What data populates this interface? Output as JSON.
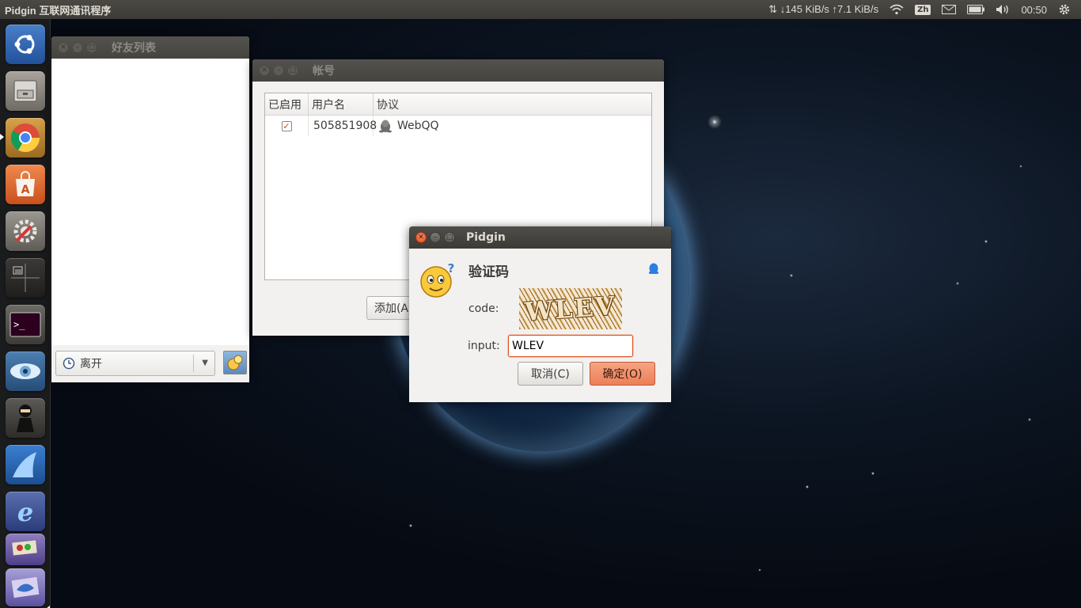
{
  "top_panel": {
    "app_title": "Pidgin 互联网通讯程序",
    "net_speed": "⇅ ↓145 KiB/s ↑7.1 KiB/s",
    "input_method": "Zh",
    "clock": "00:50",
    "icons": [
      "network-updown-icon",
      "wifi-icon",
      "mail-icon",
      "battery-icon",
      "volume-icon",
      "gear-icon"
    ]
  },
  "launcher": {
    "items": [
      "ubuntu-dash",
      "files",
      "chromium",
      "software-center",
      "system-settings",
      "workspace-switcher",
      "terminal",
      "eye-app",
      "ninja-app",
      "shark-app",
      "browser-e",
      "stacked-apps"
    ]
  },
  "buddy_window": {
    "title": "好友列表",
    "status_value": "离开"
  },
  "accounts_window": {
    "title": "帐号",
    "columns": [
      "已启用",
      "用户名",
      "协议"
    ],
    "rows": [
      {
        "enabled": true,
        "username": "505851908",
        "protocol": "WebQQ"
      }
    ],
    "add_button": "添加(A"
  },
  "captcha_dialog": {
    "title": "Pidgin",
    "heading": "验证码",
    "code_label": "code:",
    "captcha_text": "WLEV",
    "input_label": "input:",
    "input_value": "WLEV",
    "cancel_label": "取消(C)",
    "ok_label": "确定(O)"
  },
  "colors": {
    "panel_bg": "#3c3b37",
    "accent_orange": "#e2501c",
    "ok_button": "#ec7f58"
  }
}
